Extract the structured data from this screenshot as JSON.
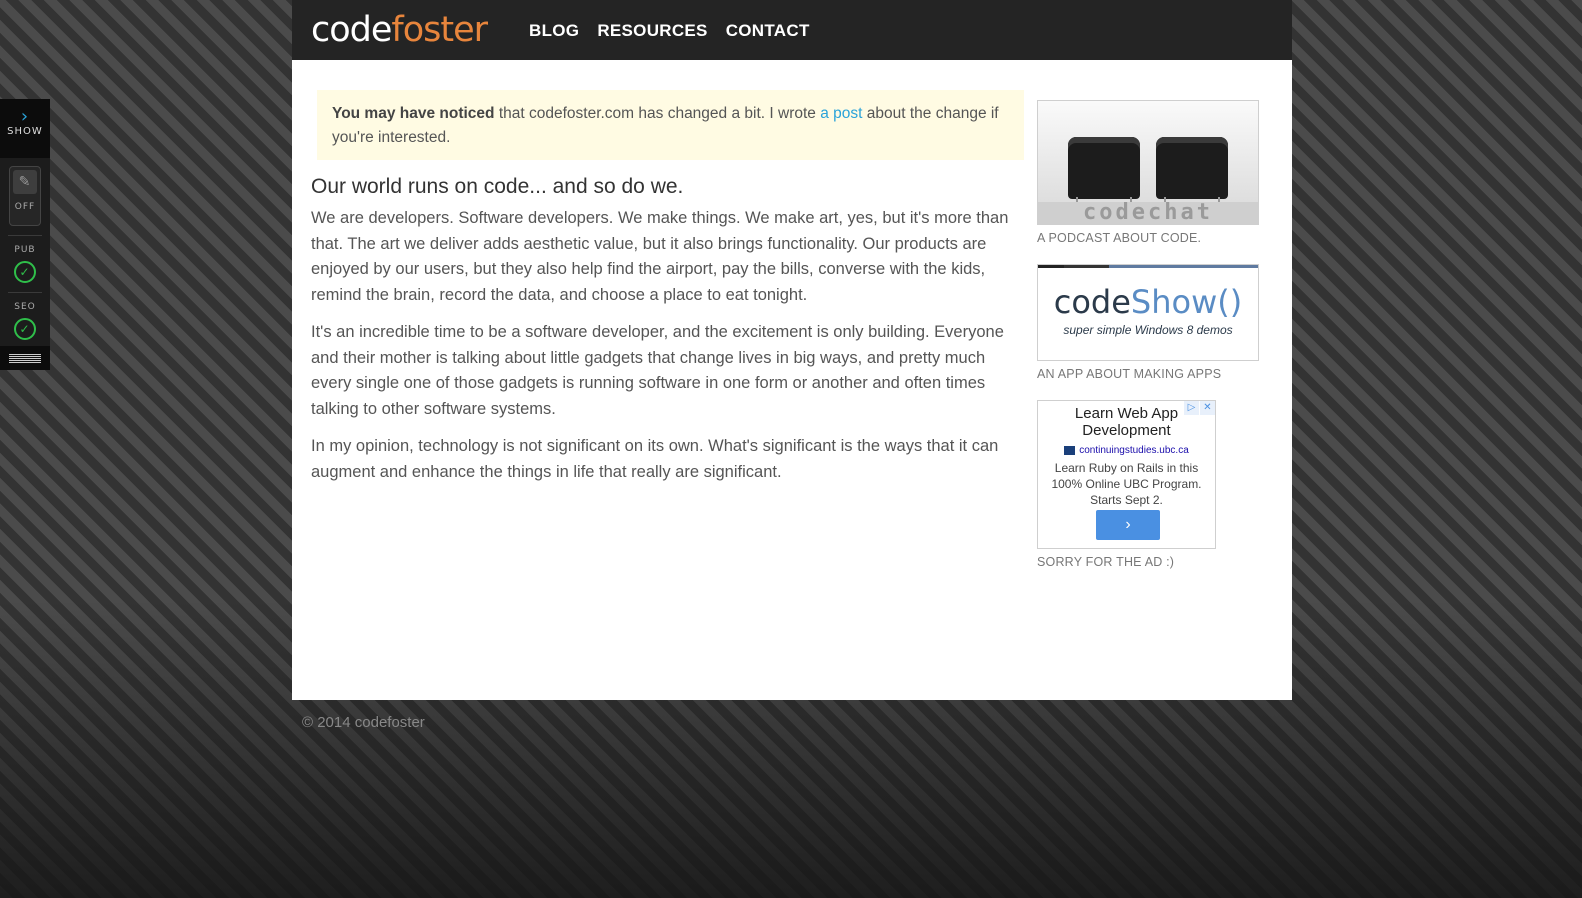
{
  "header": {
    "logo_part1": "code",
    "logo_part2": "foster",
    "nav": [
      "BLOG",
      "RESOURCES",
      "CONTACT"
    ]
  },
  "notice": {
    "bold": "You may have noticed",
    "text1": " that codefoster.com has changed a bit. I wrote ",
    "link": "a post",
    "text2": " about the change if you're interested."
  },
  "content": {
    "heading": "Our world runs on code... and so do we.",
    "paragraphs": [
      "We are developers. Software developers. We make things. We make art, yes, but it's more than that. The art we deliver adds aesthetic value, but it also brings functionality. Our products are enjoyed by our users, but they also help find the airport, pay the bills, converse with the kids, remind the brain, record the data, and choose a place to eat tonight.",
      "It's an incredible time to be a software developer, and the excitement is only building. Everyone and their mother is talking about little gadgets that change lives in big ways, and pretty much every single one of those gadgets is running software in one form or another and often times talking to other software systems.",
      "In my opinion, technology is not significant on its own. What's significant is the ways that it can augment and enhance the things in life that really are significant."
    ]
  },
  "sidebar": {
    "codechat": {
      "image_text": "codechat",
      "caption": "A PODCAST ABOUT CODE."
    },
    "codeshow": {
      "title1": "code",
      "title2": "Show()",
      "subtitle": "super simple Windows 8 demos",
      "caption": "AN APP ABOUT MAKING APPS"
    },
    "ad": {
      "title": "Learn Web App Development",
      "url": "continuingstudies.ubc.ca",
      "desc": "Learn Ruby on Rails in this 100% Online UBC Program. Starts Sept 2.",
      "button": "›",
      "caption": "SORRY FOR THE AD :)"
    }
  },
  "footer": {
    "text": "© 2014 codefoster"
  },
  "toolbar": {
    "show_label": "SHOW",
    "edit_state": "OFF",
    "pub_label": "PUB",
    "seo_label": "SEO",
    "status_color": "#2fbf4a",
    "icons": [
      "chevron-right-icon",
      "pencil-icon",
      "check-circle-icon",
      "menu-lines-icon"
    ]
  },
  "colors": {
    "accent": "#e8853c",
    "link": "#2aa3d9",
    "notice_bg": "#fffbe3"
  }
}
